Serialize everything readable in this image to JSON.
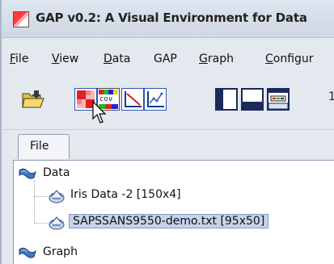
{
  "window": {
    "title": "GAP v0.2: A Visual Environment for Data"
  },
  "menubar": {
    "items": [
      {
        "key": "F",
        "rest": "ile"
      },
      {
        "key": "V",
        "rest": "iew"
      },
      {
        "key": "D",
        "rest": "ata"
      },
      {
        "key": "",
        "rest": "GAP"
      },
      {
        "key": "G",
        "rest": "raph"
      },
      {
        "key": "C",
        "rest": "onfigur"
      }
    ]
  },
  "toolbar": {
    "cov_label": "cov",
    "trailing_text": "1"
  },
  "tabs": {
    "active": "File"
  },
  "tree": {
    "root_data": "Data",
    "children": [
      "Iris Data -2 [150x4]",
      "SAPSSANS9550-demo.txt [95x50]"
    ],
    "root_graph": "Graph"
  }
}
